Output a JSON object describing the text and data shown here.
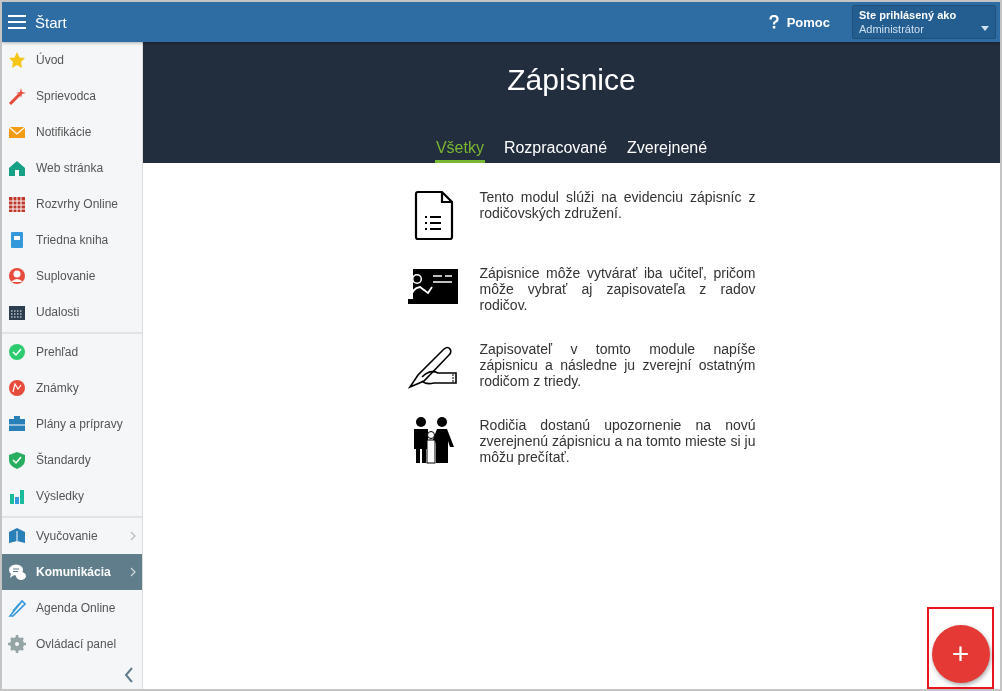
{
  "header": {
    "title": "Štart",
    "help": "Pomoc",
    "user_label": "Ste prihlásený ako",
    "user_name": "Administrátor"
  },
  "sidebar": {
    "groups": [
      [
        {
          "label": "Úvod",
          "selected": false,
          "has_submenu": false
        },
        {
          "label": "Sprievodca",
          "selected": false,
          "has_submenu": false
        },
        {
          "label": "Notifikácie",
          "selected": false,
          "has_submenu": false
        },
        {
          "label": "Web stránka",
          "selected": false,
          "has_submenu": false
        },
        {
          "label": "Rozvrhy Online",
          "selected": false,
          "has_submenu": false
        },
        {
          "label": "Triedna kniha",
          "selected": false,
          "has_submenu": false
        },
        {
          "label": "Suplovanie",
          "selected": false,
          "has_submenu": false
        },
        {
          "label": "Udalosti",
          "selected": false,
          "has_submenu": false
        }
      ],
      [
        {
          "label": "Prehľad",
          "selected": false,
          "has_submenu": false
        },
        {
          "label": "Známky",
          "selected": false,
          "has_submenu": false
        },
        {
          "label": "Plány a prípravy",
          "selected": false,
          "has_submenu": false
        },
        {
          "label": "Štandardy",
          "selected": false,
          "has_submenu": false
        },
        {
          "label": "Výsledky",
          "selected": false,
          "has_submenu": false
        }
      ],
      [
        {
          "label": "Vyučovanie",
          "selected": false,
          "has_submenu": true
        },
        {
          "label": "Komunikácia",
          "selected": true,
          "has_submenu": true
        },
        {
          "label": "Agenda Online",
          "selected": false,
          "has_submenu": false
        },
        {
          "label": "Ovládací panel",
          "selected": false,
          "has_submenu": false
        }
      ]
    ]
  },
  "page": {
    "title": "Zápisnice",
    "tabs": [
      {
        "label": "Všetky",
        "selected": true
      },
      {
        "label": "Rozpracované",
        "selected": false
      },
      {
        "label": "Zverejnené",
        "selected": false
      }
    ],
    "features": [
      {
        "text": "Tento modul slúži na evidenciu zápisníc z rodičovských združení."
      },
      {
        "text": "Zápisnice môže vytvárať iba učiteľ, pričom môže vybrať aj zapisovateľa z radov rodičov."
      },
      {
        "text": "Zapisovateľ v tomto module napíše zápisnicu a následne ju zverejní ostatným rodičom z triedy."
      },
      {
        "text": "Rodičia dostanú upozornenie na novú zverejnenú zápisnicu a na tomto mieste si ju môžu prečítať."
      }
    ]
  },
  "add_button": {
    "label": "+",
    "highlighted": true
  }
}
